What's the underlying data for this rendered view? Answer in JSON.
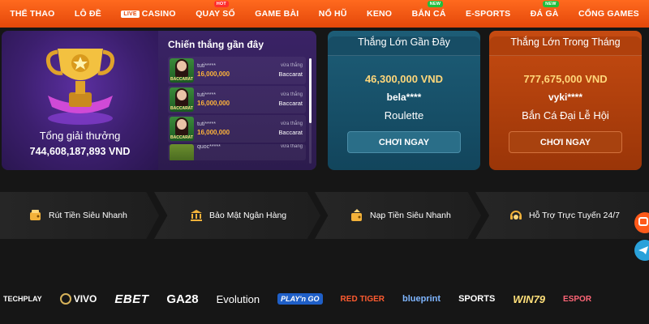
{
  "nav": {
    "items": [
      {
        "label": "THỂ THAO"
      },
      {
        "label": "LÔ ĐỀ"
      },
      {
        "label": "CASINO",
        "live": "LIVE"
      },
      {
        "label": "QUAY SỐ",
        "badge": "HOT"
      },
      {
        "label": "GAME BÀI"
      },
      {
        "label": "NỔ HŨ"
      },
      {
        "label": "KENO"
      },
      {
        "label": "BẮN CÁ",
        "badge": "NEW"
      },
      {
        "label": "E-SPORTS"
      },
      {
        "label": "ĐÁ GÀ",
        "badge": "NEW"
      },
      {
        "label": "CỔNG GAMES"
      }
    ]
  },
  "jackpot": {
    "title": "Tổng giải thưởng",
    "amount": "744,608,187,893 VND",
    "recent_title": "Chiến thắng gần đây",
    "thumb_label": "BACCARAT",
    "wins": [
      {
        "user": "tuti*****",
        "tag": "vừa thắng",
        "amount": "16,000,000",
        "game": "Baccarat"
      },
      {
        "user": "tuti*****",
        "tag": "vừa thắng",
        "amount": "16,000,000",
        "game": "Baccarat"
      },
      {
        "user": "tuti*****",
        "tag": "vừa thắng",
        "amount": "16,000,000",
        "game": "Baccarat"
      },
      {
        "user": "quoc*****",
        "tag": "vừa thắng",
        "amount": "",
        "game": ""
      }
    ]
  },
  "card_recent": {
    "title": "Thắng Lớn Gần Đây",
    "amount": "46,300,000 VND",
    "user": "bela****",
    "game": "Roulette",
    "button": "CHƠI NGAY"
  },
  "card_month": {
    "title": "Thắng Lớn Trong Tháng",
    "amount": "777,675,000 VND",
    "user": "vyki****",
    "game": "Bắn Cá Đại Lễ Hội",
    "button": "CHƠI NGAY"
  },
  "features": [
    {
      "label": "Rút Tiền Siêu Nhanh",
      "icon": "wallet-icon"
    },
    {
      "label": "Bảo Mật Ngân Hàng",
      "icon": "bank-icon"
    },
    {
      "label": "Nạp Tiền Siêu Nhanh",
      "icon": "deposit-icon"
    },
    {
      "label": "Hỗ Trợ Trực Tuyến 24/7",
      "icon": "headset-icon"
    }
  ],
  "providers": [
    "TECHPLAY",
    "VIVO",
    "EBET",
    "GA28",
    "Evolution",
    "PLAY'n GO",
    "RED TIGER",
    "blueprint",
    "SPORTS",
    "WIN79",
    "ESPOR"
  ],
  "colors": {
    "nav": "#e4480a",
    "jackpot_bg": "#3c1f6e",
    "card_blue": "#1d5d77",
    "card_orange": "#c64b11",
    "gold": "#ffd77a"
  }
}
